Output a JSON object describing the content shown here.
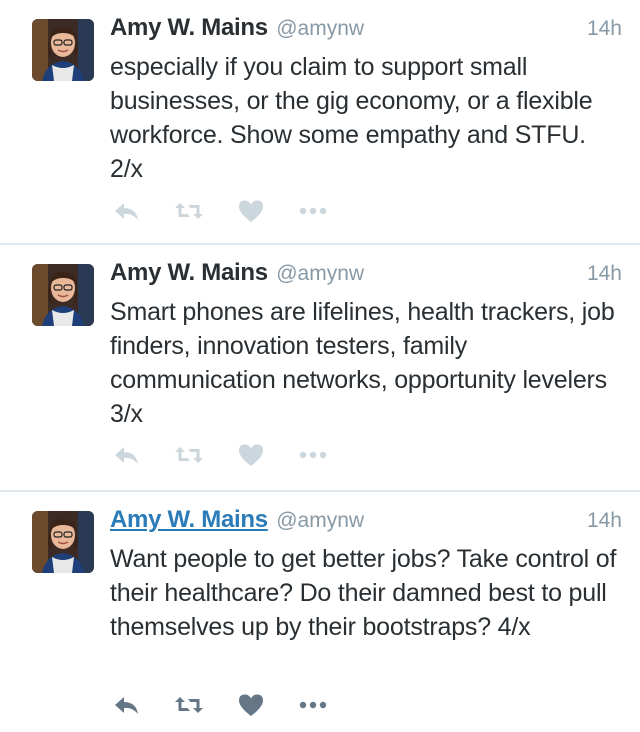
{
  "colors": {
    "link": "#2b7bb9",
    "muted": "#8899a6",
    "text": "#292f33",
    "icon_dim": "#ccd6dd",
    "icon_active": "#657786",
    "divider": "#e1e8ed"
  },
  "tweets": [
    {
      "author_name": "Amy W. Mains",
      "handle": "@amynw",
      "time": "14h",
      "text": "especially if you claim to support small businesses, or the gig economy, or a flexible workforce. Show some empathy and STFU. 2/x",
      "actions": [
        "reply-icon",
        "retweet-icon",
        "like-icon",
        "more-icon"
      ]
    },
    {
      "author_name": "Amy W. Mains",
      "handle": "@amynw",
      "time": "14h",
      "text": "Smart phones are lifelines, health trackers, job finders, innovation testers, family communication networks, opportunity levelers 3/x",
      "actions": [
        "reply-icon",
        "retweet-icon",
        "like-icon",
        "more-icon"
      ]
    },
    {
      "author_name": "Amy W. Mains",
      "handle": "@amynw",
      "time": "14h",
      "text": "Want people to get better jobs? Take control of their healthcare? Do their damned best to pull themselves up by their bootstraps? 4/x",
      "actions": [
        "reply-icon",
        "retweet-icon",
        "like-icon",
        "more-icon"
      ]
    }
  ]
}
